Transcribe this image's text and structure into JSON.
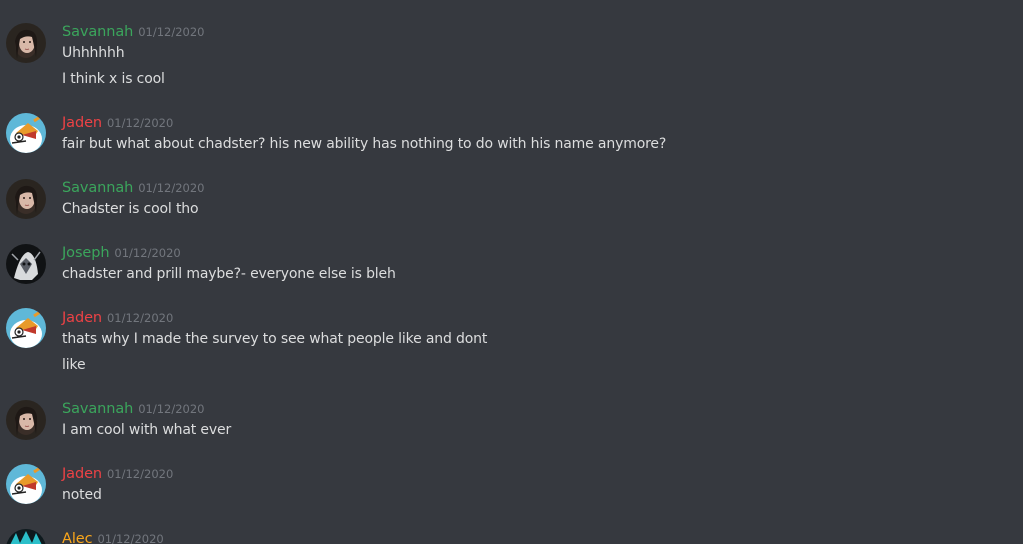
{
  "colors": {
    "background": "#36393f",
    "savannah": "#3ba55c",
    "jaden": "#ed4245",
    "joseph": "#3ba55c",
    "alec": "#faa61a",
    "timestamp": "#72767d",
    "text": "#dcddde"
  },
  "messages": [
    {
      "author": "Savannah",
      "avatar": "savannah-avatar-icon",
      "timestamp": "01/12/2020",
      "lines": [
        "Uhhhhhh",
        "I think x is cool"
      ]
    },
    {
      "author": "Jaden",
      "avatar": "jaden-avatar-icon",
      "timestamp": "01/12/2020",
      "lines": [
        "fair but what about chadster? his new ability has nothing to do with his name anymore?"
      ]
    },
    {
      "author": "Savannah",
      "avatar": "savannah-avatar-icon",
      "timestamp": "01/12/2020",
      "lines": [
        "Chadster is cool tho"
      ]
    },
    {
      "author": "Joseph",
      "avatar": "joseph-avatar-icon",
      "timestamp": "01/12/2020",
      "lines": [
        "chadster and prill maybe?- everyone else is bleh"
      ]
    },
    {
      "author": "Jaden",
      "avatar": "jaden-avatar-icon",
      "timestamp": "01/12/2020",
      "lines": [
        "thats why I made the survey to see what people like and dont",
        "like"
      ]
    },
    {
      "author": "Savannah",
      "avatar": "savannah-avatar-icon",
      "timestamp": "01/12/2020",
      "lines": [
        "I am cool with what ever"
      ]
    },
    {
      "author": "Jaden",
      "avatar": "jaden-avatar-icon",
      "timestamp": "01/12/2020",
      "lines": [
        "noted"
      ]
    },
    {
      "author": "Alec",
      "avatar": "alec-avatar-icon",
      "timestamp": "01/12/2020",
      "lines": []
    }
  ]
}
